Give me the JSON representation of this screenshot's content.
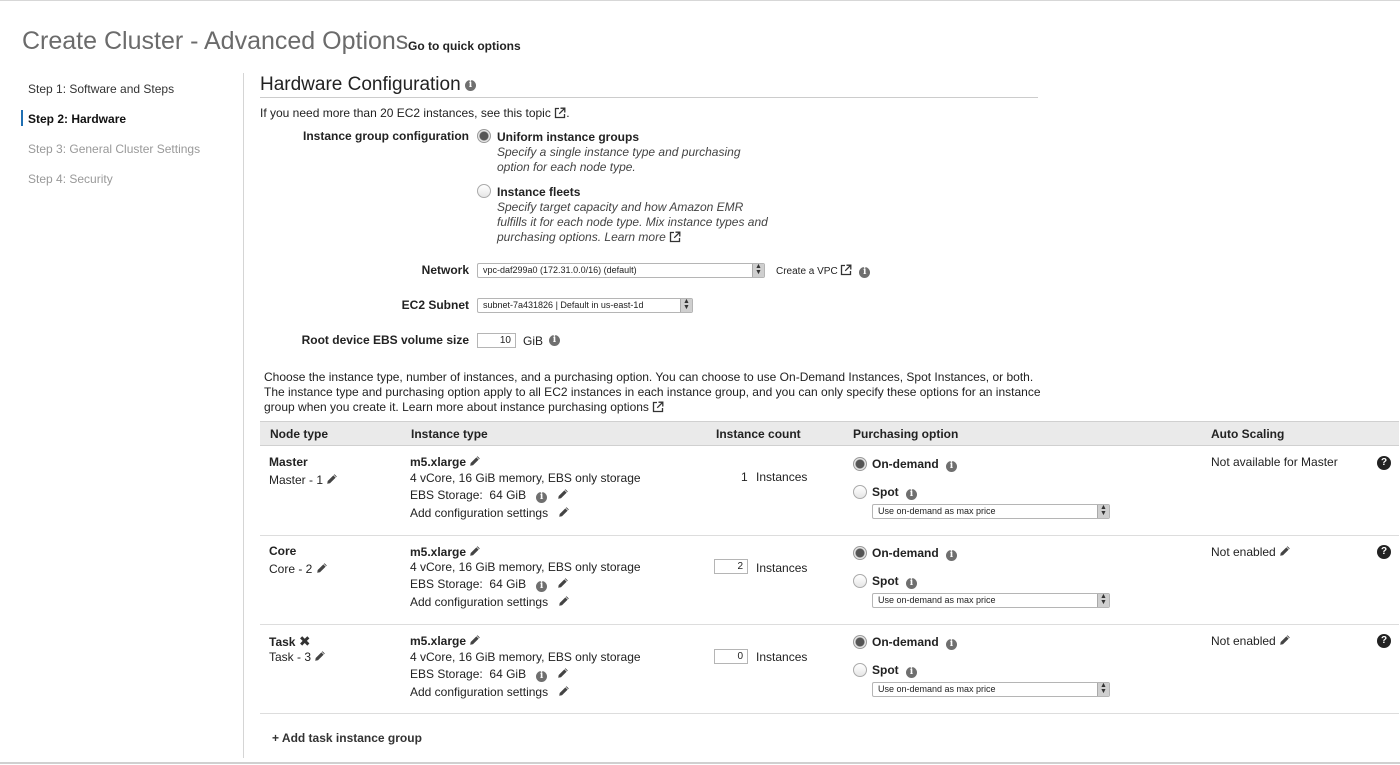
{
  "header": {
    "title": "Create Cluster - Advanced Options",
    "quick_options": "Go to quick options"
  },
  "steps": [
    {
      "label": "Step 1: Software and Steps"
    },
    {
      "label": "Step 2: Hardware"
    },
    {
      "label": "Step 3: General Cluster Settings"
    },
    {
      "label": "Step 4: Security"
    }
  ],
  "hardware": {
    "title": "Hardware Configuration",
    "note_prefix": "If you need more than 20 EC2 instances, ",
    "note_link": "see this topic",
    "note_suffix": ".",
    "group_config_label": "Instance group configuration",
    "uniform_title": "Uniform instance groups",
    "uniform_desc_1": "Specify a single instance type and purchasing",
    "uniform_desc_2": "option for each node type.",
    "fleets_title": "Instance fleets",
    "fleets_desc_1": "Specify target capacity and how Amazon EMR",
    "fleets_desc_2": "fulfills it for each node type. Mix instance types and",
    "fleets_desc_3": "purchasing options. Learn more",
    "network_label": "Network",
    "network_value": "vpc-daf299a0 (172.31.0.0/16) (default)",
    "create_vpc": "Create a VPC",
    "subnet_label": "EC2 Subnet",
    "subnet_value": "subnet-7a431826 | Default in us-east-1d",
    "ebs_label": "Root device EBS volume size",
    "ebs_value": "10",
    "ebs_unit": "GiB",
    "desc_1": "Choose the instance type, number of instances, and a purchasing option. You can choose to use On-Demand Instances, Spot Instances, or both.",
    "desc_2": "The instance type and purchasing option apply to all EC2 instances in each instance group, and you can only specify these options for an instance",
    "desc_3": "group when you create it. ",
    "desc_link": "Learn more about instance purchasing options"
  },
  "table": {
    "headers": [
      "Node type",
      "Instance type",
      "Instance count",
      "Purchasing option",
      "Auto Scaling"
    ],
    "rows": [
      {
        "node": "Master",
        "sub": "Master - 1",
        "type": "m5.xlarge",
        "spec": "4 vCore, 16 GiB memory, EBS only storage",
        "ebs_label": "EBS Storage:",
        "ebs_value": "64 GiB",
        "config": "Add configuration settings",
        "count": "1",
        "count_unit": "Instances",
        "ondemand": "On-demand",
        "spot": "Spot",
        "max_price": "Use on-demand as max price",
        "autoscaling": "Not available for Master"
      },
      {
        "node": "Core",
        "sub": "Core - 2",
        "type": "m5.xlarge",
        "spec": "4 vCore, 16 GiB memory, EBS only storage",
        "ebs_label": "EBS Storage:",
        "ebs_value": "64 GiB",
        "config": "Add configuration settings",
        "count": "2",
        "count_unit": "Instances",
        "ondemand": "On-demand",
        "spot": "Spot",
        "max_price": "Use on-demand as max price",
        "autoscaling": "Not enabled"
      },
      {
        "node": "Task",
        "sub": "Task - 3",
        "type": "m5.xlarge",
        "spec": "4 vCore, 16 GiB memory, EBS only storage",
        "ebs_label": "EBS Storage:",
        "ebs_value": "64 GiB",
        "config": "Add configuration settings",
        "count": "0",
        "count_unit": "Instances",
        "ondemand": "On-demand",
        "spot": "Spot",
        "max_price": "Use on-demand as max price",
        "autoscaling": "Not enabled"
      }
    ],
    "add_task": "+ Add task instance group"
  },
  "icons": {
    "info": "info-icon",
    "external": "external-link-icon",
    "edit": "pencil-icon",
    "help": "help-icon",
    "remove": "close-icon"
  }
}
